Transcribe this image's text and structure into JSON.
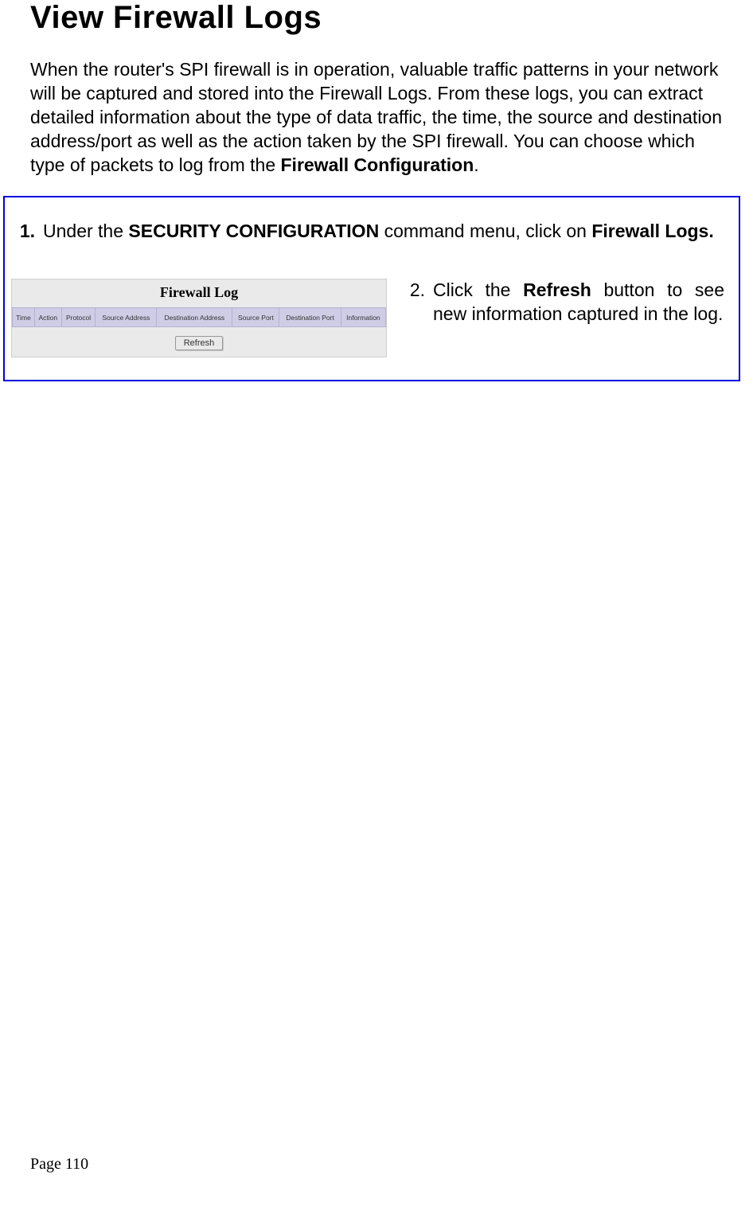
{
  "title": "View Firewall Logs",
  "intro": {
    "text_before": "When the router's SPI firewall is in operation, valuable traffic patterns in your network will be captured and stored into the Firewall Logs. From these logs, you can extract detailed information about the type of data traffic, the time, the source and destination address/port as well as the action taken by the SPI firewall. You can choose which type of packets to log from the ",
    "bold": "Firewall Configuration",
    "text_after": "."
  },
  "step1": {
    "number": "1.",
    "t1": "Under the ",
    "b1": "SECURITY CONFIGURATION",
    "t2": " command menu, click on ",
    "b2": "Firewall Logs."
  },
  "screenshot": {
    "panel_title": "Firewall Log",
    "columns": [
      "Time",
      "Action",
      "Protocol",
      "Source Address",
      "Destination Address",
      "Source Port",
      "Destination Port",
      "Information"
    ],
    "refresh_label": "Refresh"
  },
  "step2": {
    "number": "2.",
    "t1": "Click the ",
    "b1": "Refresh",
    "t2": " button to see new information captured in the log."
  },
  "page_number": "Page 110"
}
